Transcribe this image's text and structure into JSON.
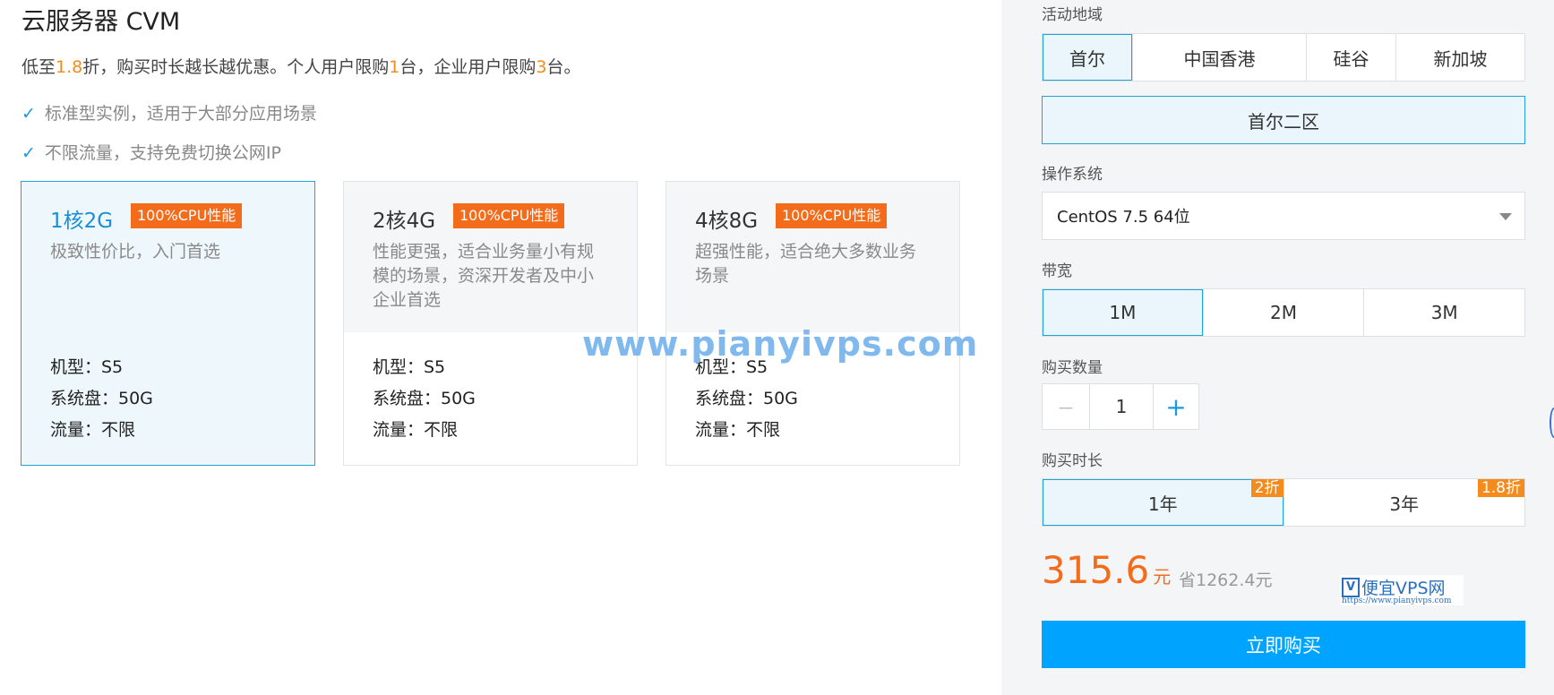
{
  "product": {
    "title": "云服务器 CVM",
    "intro_pre": "低至",
    "intro_discount": "1.8",
    "intro_mid": "折，购买时长越长越优惠。个人用户限购",
    "intro_personal_limit": "1",
    "intro_mid2": "台，企业用户限购",
    "intro_enterprise_limit": "3",
    "intro_post": "台。",
    "features": [
      "标准型实例，适用于大部分应用场景",
      "不限流量，支持免费切换公网IP"
    ],
    "check_glyph": "✓"
  },
  "cards": [
    {
      "name": "1核2G",
      "badge": "100%CPU性能",
      "desc": "极致性价比，入门首选",
      "specs": [
        "机型：S5",
        "系统盘：50G",
        "流量：不限"
      ],
      "selected": true
    },
    {
      "name": "2核4G",
      "badge": "100%CPU性能",
      "desc": "性能更强，适合业务量小有规模的场景，资深开发者及中小企业首选",
      "specs": [
        "机型：S5",
        "系统盘：50G",
        "流量：不限"
      ],
      "selected": false
    },
    {
      "name": "4核8G",
      "badge": "100%CPU性能",
      "desc": "超强性能，适合绝大多数业务场景",
      "specs": [
        "机型：S5",
        "系统盘：50G",
        "流量：不限"
      ],
      "selected": false
    }
  ],
  "watermark": "www.pianyivps.com",
  "config": {
    "region_label": "活动地域",
    "regions": [
      "首尔",
      "中国香港",
      "硅谷",
      "新加坡"
    ],
    "zone": "首尔二区",
    "os_label": "操作系统",
    "os_value": "CentOS 7.5 64位",
    "bandwidth_label": "带宽",
    "bandwidths": [
      "1M",
      "2M",
      "3M"
    ],
    "quantity_label": "购买数量",
    "quantity": "1",
    "minus": "－",
    "plus": "+",
    "duration_label": "购买时长",
    "durations": [
      {
        "label": "1年",
        "discount": "2折"
      },
      {
        "label": "3年",
        "discount": "1.8折"
      }
    ],
    "price": "315.6",
    "price_unit": "元",
    "savings": "省1262.4元",
    "buy_button": "立即购买"
  },
  "logo": {
    "mark": "V",
    "name": "便宜VPS网",
    "url": "https://www.pianyivps.com"
  },
  "colors": {
    "accent": "#00a4ff",
    "selected_border": "#21a3d4",
    "orange": "#f26c1c",
    "highlight": "#f48b1c"
  }
}
